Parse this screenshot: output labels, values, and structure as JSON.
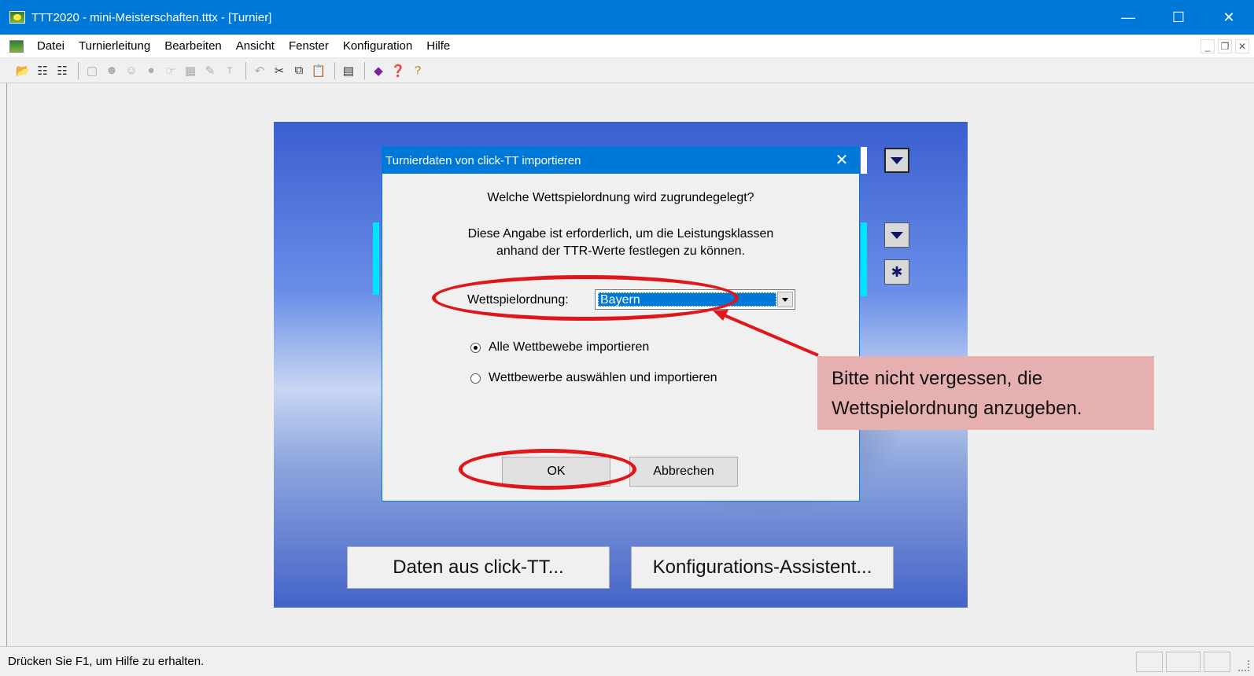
{
  "window": {
    "title": "TTT2020 - mini-Meisterschaften.tttx - [Turnier]"
  },
  "menu": {
    "items": [
      "Datei",
      "Turnierleitung",
      "Bearbeiten",
      "Ansicht",
      "Fenster",
      "Konfiguration",
      "Hilfe"
    ]
  },
  "dialog": {
    "title": "Turnierdaten von click-TT importieren",
    "question": "Welche Wettspielordnung wird zugrundegelegt?",
    "info_line1": "Diese Angabe ist erforderlich, um die Leistungsklassen",
    "info_line2": "anhand der TTR-Werte festlegen zu können.",
    "wso_label": "Wettspielordnung:",
    "wso_value": "Bayern",
    "radio1": "Alle Wettbewebe importieren",
    "radio2": "Wettbewerbe auswählen und importieren",
    "ok": "OK",
    "cancel": "Abbrechen"
  },
  "main_buttons": {
    "clicktt": "Daten aus click-TT...",
    "assistant": "Konfigurations-Assistent..."
  },
  "callout": {
    "line1": "Bitte nicht vergessen, die",
    "line2": "Wettspielordnung anzugeben."
  },
  "status": {
    "text": "Drücken Sie F1, um Hilfe zu erhalten."
  },
  "colors": {
    "titlebar": "#0078d7",
    "annotation": "#e0161a",
    "callout_bg": "#e6b0b0"
  }
}
